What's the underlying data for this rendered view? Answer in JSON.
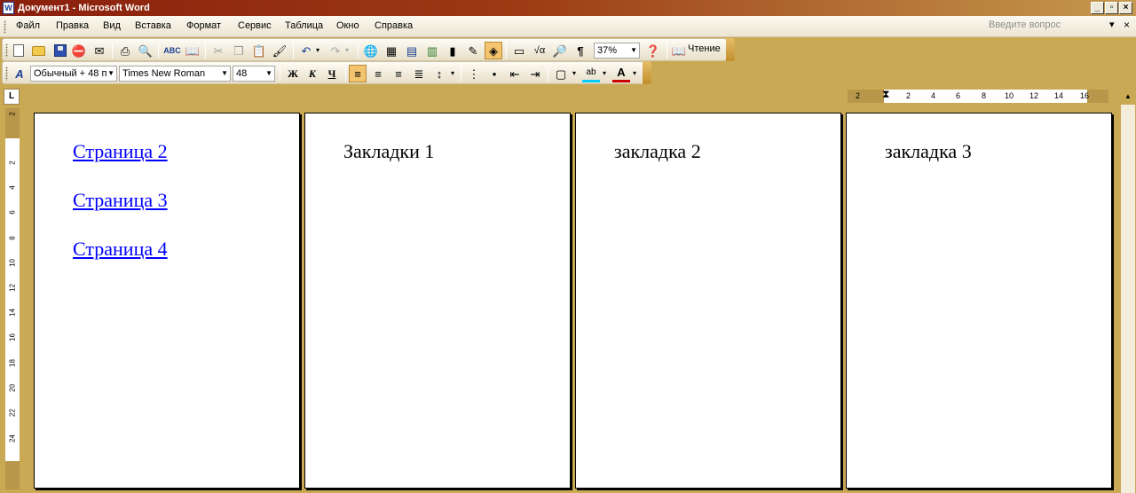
{
  "window": {
    "title": "Документ1 - Microsoft Word",
    "controls": [
      "_",
      "▫",
      "×"
    ]
  },
  "menu": {
    "items": [
      "Файл",
      "Правка",
      "Вид",
      "Вставка",
      "Формат",
      "Сервис",
      "Таблица",
      "Окно",
      "Справка"
    ],
    "ask_placeholder": "Введите вопрос"
  },
  "standard_toolbar": {
    "zoom": "37%",
    "read_label": "Чтение"
  },
  "formatting_toolbar": {
    "style": "Обычный + 48 п",
    "font": "Times New Roman",
    "size": "48",
    "bold": "Ж",
    "italic": "К",
    "underline": "Ч"
  },
  "rulers": {
    "corner": "L",
    "horizontal_ticks": [
      "2",
      "2",
      "4",
      "6",
      "8",
      "10",
      "12",
      "14",
      "16"
    ],
    "vertical_ticks": [
      "2",
      "2",
      "4",
      "6",
      "8",
      "10",
      "12",
      "14",
      "16",
      "18",
      "20",
      "22",
      "24"
    ]
  },
  "pages": [
    {
      "links": [
        "Страница 2",
        "Страница 3",
        "Страница 4"
      ]
    },
    {
      "heading": "Закладки 1"
    },
    {
      "heading": "закладка 2"
    },
    {
      "heading": "закладка 3"
    }
  ],
  "colors": {
    "link": "#0000ff",
    "workspace": "#c9a954",
    "titlebar": "#8a1f0c"
  }
}
